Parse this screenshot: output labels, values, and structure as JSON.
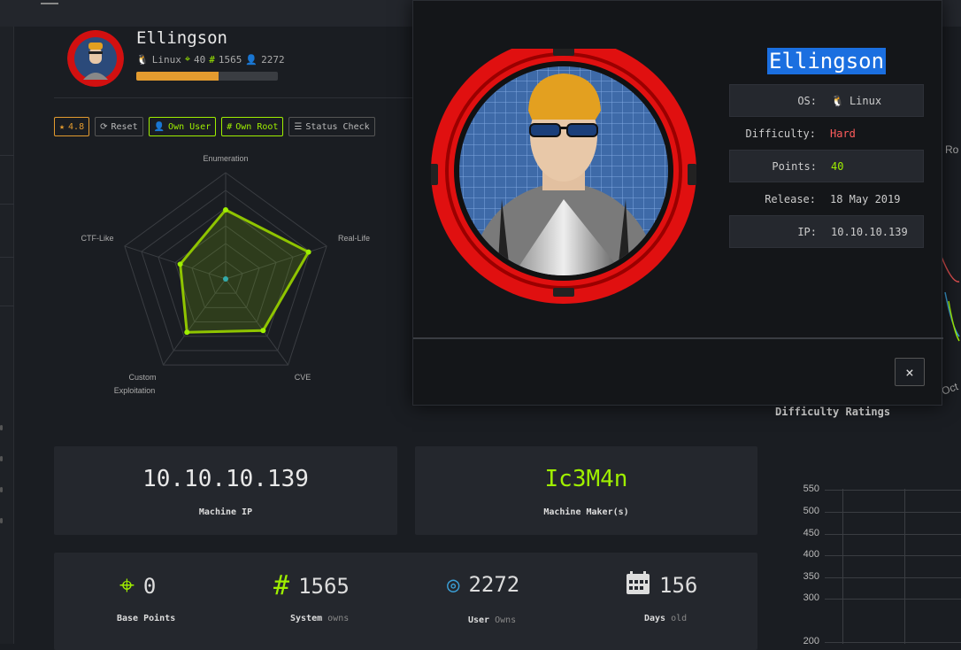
{
  "machine": {
    "name": "Ellingson",
    "os": "Linux",
    "points": "40",
    "system_owns": "1565",
    "user_owns": "2272",
    "progress": 0.58,
    "rating": "4.8"
  },
  "buttons": {
    "reset": "Reset",
    "own_user": "Own User",
    "own_root": "Own Root",
    "status_check": "Status Check"
  },
  "radar": {
    "labels": [
      "Enumeration",
      "Real-Life",
      "CVE",
      "Custom",
      "Exploitation",
      "CTF-Like"
    ],
    "values": [
      0.65,
      0.82,
      0.6,
      0.62,
      0.45
    ]
  },
  "cards": {
    "ip": "10.10.10.139",
    "ip_label": "Machine IP",
    "maker": "Ic3M4n",
    "maker_label": "Machine Maker(s)"
  },
  "stats": {
    "base_points": "0",
    "base_points_label": "Base Points",
    "system": "1565",
    "system_label": "System",
    "system_suffix": "owns",
    "user": "2272",
    "user_label": "User",
    "user_suffix": "Owns",
    "days": "156",
    "days_label": "Days",
    "days_suffix": "old"
  },
  "difficulty": {
    "title": "Difficulty Ratings",
    "ticks": [
      "550",
      "500",
      "450",
      "400",
      "350",
      "300",
      "200"
    ]
  },
  "edge": {
    "ro": "Ro",
    "oct": "Oct"
  },
  "modal": {
    "title": "Ellingson",
    "os_label": "OS:",
    "os": "Linux",
    "difficulty_label": "Difficulty:",
    "difficulty": "Hard",
    "points_label": "Points:",
    "points": "40",
    "release_label": "Release:",
    "release": "18 May 2019",
    "ip_label": "IP:",
    "ip": "10.10.10.139",
    "close": "×"
  },
  "colors": {
    "accent": "#9fef00",
    "orange": "#e39b2f",
    "red": "#ff5c5c",
    "blue": "#3ba0d8"
  }
}
